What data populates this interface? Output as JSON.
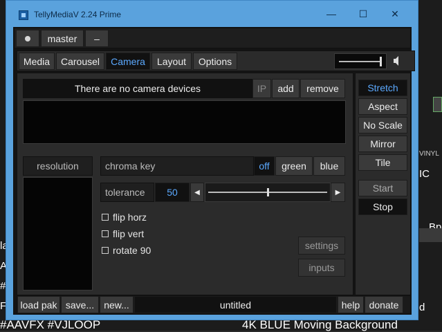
{
  "window": {
    "title": "TellyMediaV 2.24 Prime",
    "minimize_glyph": "—",
    "maximize_glyph": "☐",
    "close_glyph": "✕"
  },
  "top_bar": {
    "master_label": "master",
    "minus_label": "–"
  },
  "tabs": [
    {
      "label": "Media",
      "selected": false
    },
    {
      "label": "Carousel",
      "selected": false
    },
    {
      "label": "Camera",
      "selected": true
    },
    {
      "label": "Layout",
      "selected": false
    },
    {
      "label": "Options",
      "selected": false
    }
  ],
  "volume": {
    "level": 1.0,
    "icon": "speaker-icon"
  },
  "camera": {
    "status_text": "There are no camera devices",
    "ip_label": "IP",
    "add_label": "add",
    "remove_label": "remove",
    "resolution_label": "resolution",
    "chroma_key_label": "chroma key",
    "chroma_options": [
      "off",
      "green",
      "blue"
    ],
    "chroma_selected": "off",
    "tolerance_label": "tolerance",
    "tolerance_value": "50",
    "tolerance_fraction": 0.5,
    "checkboxes": [
      {
        "label": "flip horz",
        "checked": false
      },
      {
        "label": "flip vert",
        "checked": false
      },
      {
        "label": "rotate 90",
        "checked": false
      }
    ],
    "settings_label": "settings",
    "inputs_label": "inputs"
  },
  "scale_buttons": [
    {
      "label": "Stretch",
      "selected": true
    },
    {
      "label": "Aspect",
      "selected": false
    },
    {
      "label": "No Scale",
      "selected": false
    },
    {
      "label": "Mirror",
      "selected": false
    },
    {
      "label": "Tile",
      "selected": false
    }
  ],
  "start_label": "Start",
  "stop_label": "Stop",
  "bottom_bar": {
    "load_pak_label": "load pak",
    "save_label": "save...",
    "new_label": "new...",
    "filename": "untitled",
    "help_label": "help",
    "donate_label": "donate"
  },
  "background": {
    "line1": "#AAVFX #VJLOOP",
    "line2": "4K BLUE Moving Background",
    "vinyl_label": "VINYL",
    "frag_ic": "IC",
    "frag_bp": "Bp",
    "frag_d": "d",
    "frag_la": "la",
    "frag_ar": "AF",
    "frag_hash": "#/",
    "frag_fx": "FX"
  },
  "colors": {
    "accent": "#5ba9ff",
    "titlebar": "#5aa2dd"
  }
}
